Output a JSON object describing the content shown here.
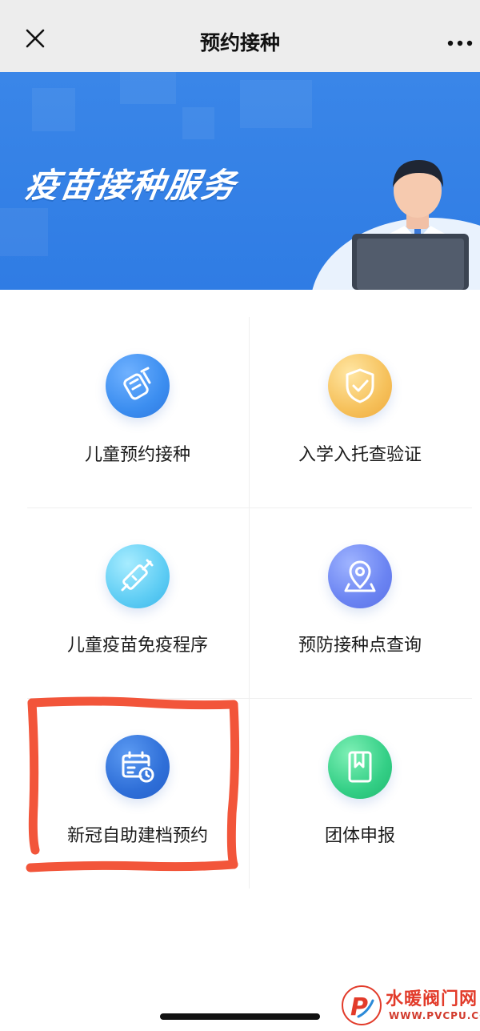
{
  "header": {
    "title": "预约接种"
  },
  "banner": {
    "title": "疫苗接种服务"
  },
  "services": [
    {
      "label": "儿童预约接种",
      "icon": "syringe-vial-icon"
    },
    {
      "label": "入学入托查验证",
      "icon": "shield-check-icon"
    },
    {
      "label": "儿童疫苗免疫程序",
      "icon": "syringe-icon"
    },
    {
      "label": "预防接种点查询",
      "icon": "location-pin-icon"
    },
    {
      "label": "新冠自助建档预约",
      "icon": "calendar-clock-icon"
    },
    {
      "label": "团体申报",
      "icon": "bookmark-book-icon"
    }
  ],
  "watermark": {
    "brand": "水暖阀门网",
    "url": "WWW.PVCPU.COM"
  },
  "colors": {
    "banner": "#2f7ce4",
    "highlight": "#f2553a",
    "header_bg": "#ededed"
  }
}
